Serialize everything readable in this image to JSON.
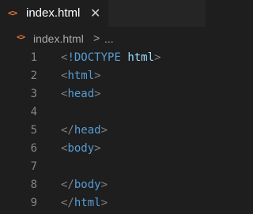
{
  "tab": {
    "icon": "<>",
    "title": "index.html",
    "close": "✕"
  },
  "breadcrumb": {
    "icon": "<>",
    "file": "index.html",
    "separator": ">",
    "more": "..."
  },
  "editor": {
    "lines": [
      {
        "number": "1",
        "open": "<",
        "tag": "!DOCTYPE",
        "space": " ",
        "attr": "html",
        "close": ">"
      },
      {
        "number": "2",
        "open": "<",
        "tag": "html",
        "space": "",
        "attr": "",
        "close": ">"
      },
      {
        "number": "3",
        "open": "<",
        "tag": "head",
        "space": "",
        "attr": "",
        "close": ">"
      },
      {
        "number": "4",
        "open": "",
        "tag": "",
        "space": "",
        "attr": "",
        "close": ""
      },
      {
        "number": "5",
        "open": "</",
        "tag": "head",
        "space": "",
        "attr": "",
        "close": ">"
      },
      {
        "number": "6",
        "open": "<",
        "tag": "body",
        "space": "",
        "attr": "",
        "close": ">"
      },
      {
        "number": "7",
        "open": "",
        "tag": "",
        "space": "",
        "attr": "",
        "close": ""
      },
      {
        "number": "8",
        "open": "</",
        "tag": "body",
        "space": "",
        "attr": "",
        "close": ">"
      },
      {
        "number": "9",
        "open": "</",
        "tag": "html",
        "space": "",
        "attr": "",
        "close": ">"
      }
    ]
  },
  "colors": {
    "background": "#1e1e1e",
    "tabbar": "#252526",
    "html_icon": "#e37933",
    "line_number": "#858585",
    "punctuation": "#808080",
    "tag": "#569cd6",
    "attribute": "#9cdcfe"
  }
}
